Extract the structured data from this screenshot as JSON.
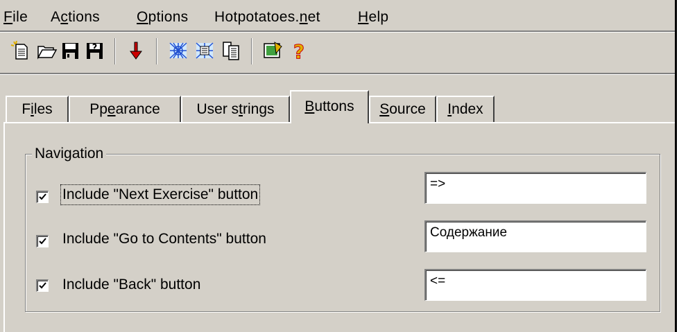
{
  "menu": {
    "file": "File",
    "actions": "Actions",
    "options": "Options",
    "hotpotatoes": "Hotpotatoes.net",
    "help": "Help"
  },
  "toolbar": {
    "buttons": [
      "new-icon",
      "open-icon",
      "save-icon",
      "save-as-icon",
      "export-icon",
      "web-page-icon",
      "web-page-alt-icon",
      "copy-icon",
      "tutorial-icon",
      "help-icon"
    ]
  },
  "tabs": {
    "files": "Files",
    "appearance": "Appearance",
    "user_strings": "User strings",
    "buttons": "Buttons",
    "source": "Source",
    "index": "Index",
    "active": "Buttons"
  },
  "navigation": {
    "title": "Navigation",
    "rows": [
      {
        "label": "Include \"Next Exercise\" button",
        "checked": true,
        "value": "=>"
      },
      {
        "label": "Include \"Go to Contents\" button",
        "checked": true,
        "value": "Содержание"
      },
      {
        "label": "Include \"Back\" button",
        "checked": true,
        "value": "<="
      }
    ]
  },
  "colors": {
    "face": "#d4d0c8",
    "shadow": "#808080",
    "highlight": "#ffffff",
    "export_arrow": "#cc0000",
    "help_mark": "#e0b000"
  }
}
